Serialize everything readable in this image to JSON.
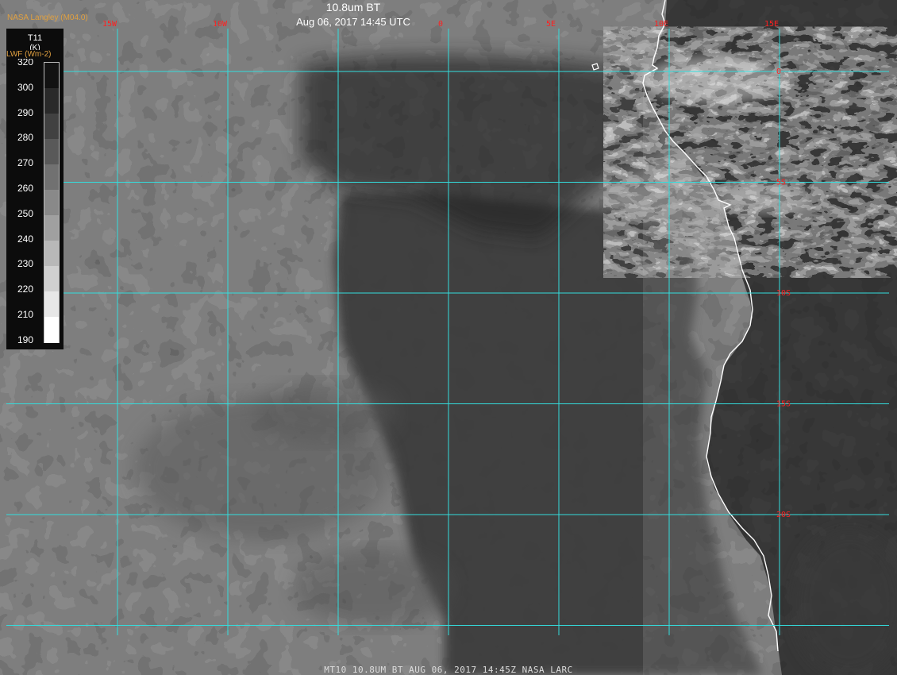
{
  "header": {
    "title": "10.8um BT",
    "datetime": "Aug 06, 2017 14:45 UTC",
    "provider": "NASA Langley (M04.0)"
  },
  "legend": {
    "variable": "T11",
    "unit": "(K)",
    "sub_label": "LWF (Wm-2)",
    "ticks": [
      320,
      300,
      290,
      280,
      270,
      260,
      250,
      240,
      230,
      220,
      210,
      190
    ],
    "range": [
      190,
      320
    ]
  },
  "grid": {
    "longitudes": [
      {
        "label": "15W",
        "value": -15
      },
      {
        "label": "10W",
        "value": -10
      },
      {
        "label": "0",
        "value": 0
      },
      {
        "label": "5E",
        "value": 5
      },
      {
        "label": "10E",
        "value": 10
      },
      {
        "label": "15E",
        "value": 15
      }
    ],
    "lon_extra_line": -5,
    "latitudes": [
      {
        "label": "0",
        "value": 0
      },
      {
        "label": "5S",
        "value": -5
      },
      {
        "label": "10S",
        "value": -10
      },
      {
        "label": "15S",
        "value": -15
      },
      {
        "label": "20S",
        "value": -20
      }
    ],
    "lat_extra_line": -25
  },
  "footer": {
    "caption": "MT10  10.8UM BT   AUG 06, 2017 14:45Z   NASA LARC"
  },
  "colors": {
    "grid": "#33dddd",
    "grid_label": "#ff2020",
    "coast": "#ffffff",
    "ocean": "#3a3a3a",
    "land": "#121212",
    "cloud": "#cfcfcf"
  }
}
